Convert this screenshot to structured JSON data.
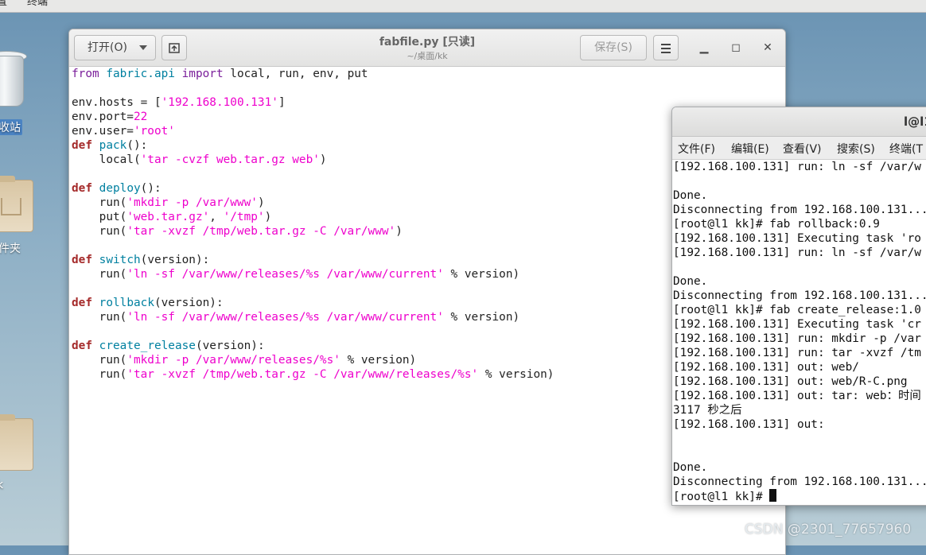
{
  "topbar": {
    "menu_partial": "置",
    "terminal_menu": "终端"
  },
  "desktop": {
    "trash_label": "收站",
    "folder1_label": "件夹",
    "folder2_label": "k"
  },
  "editor": {
    "open_label": "打开(O)",
    "save_label": "保存(S)",
    "title": "fabfile.py [只读]",
    "subtitle": "~/桌面/kk",
    "code_lines": [
      [
        {
          "t": "from",
          "c": "kw2"
        },
        {
          "t": " "
        },
        {
          "t": "fabric.api",
          "c": "fn"
        },
        {
          "t": " "
        },
        {
          "t": "import",
          "c": "kw2"
        },
        {
          "t": " local, run, env, put"
        }
      ],
      [],
      [
        {
          "t": "env.hosts = ["
        },
        {
          "t": "'192.168.100.131'",
          "c": "str"
        },
        {
          "t": "]"
        }
      ],
      [
        {
          "t": "env.port="
        },
        {
          "t": "22",
          "c": "num"
        }
      ],
      [
        {
          "t": "env.user="
        },
        {
          "t": "'root'",
          "c": "str"
        }
      ],
      [
        {
          "t": "def",
          "c": "kw"
        },
        {
          "t": " "
        },
        {
          "t": "pack",
          "c": "fn"
        },
        {
          "t": "():"
        }
      ],
      [
        {
          "t": "    local("
        },
        {
          "t": "'tar -cvzf web.tar.gz web'",
          "c": "str"
        },
        {
          "t": ")"
        }
      ],
      [],
      [
        {
          "t": "def",
          "c": "kw"
        },
        {
          "t": " "
        },
        {
          "t": "deploy",
          "c": "fn"
        },
        {
          "t": "():"
        }
      ],
      [
        {
          "t": "    run("
        },
        {
          "t": "'mkdir -p /var/www'",
          "c": "str"
        },
        {
          "t": ")"
        }
      ],
      [
        {
          "t": "    put("
        },
        {
          "t": "'web.tar.gz'",
          "c": "str"
        },
        {
          "t": ", "
        },
        {
          "t": "'/tmp'",
          "c": "str"
        },
        {
          "t": ")"
        }
      ],
      [
        {
          "t": "    run("
        },
        {
          "t": "'tar -xvzf /tmp/web.tar.gz -C /var/www'",
          "c": "str"
        },
        {
          "t": ")"
        }
      ],
      [],
      [
        {
          "t": "def",
          "c": "kw"
        },
        {
          "t": " "
        },
        {
          "t": "switch",
          "c": "fn"
        },
        {
          "t": "(version):"
        }
      ],
      [
        {
          "t": "    run("
        },
        {
          "t": "'ln -sf /var/www/releases/%s /var/www/current'",
          "c": "str"
        },
        {
          "t": " % version)"
        }
      ],
      [],
      [
        {
          "t": "def",
          "c": "kw"
        },
        {
          "t": " "
        },
        {
          "t": "rollback",
          "c": "fn"
        },
        {
          "t": "(version):"
        }
      ],
      [
        {
          "t": "    run("
        },
        {
          "t": "'ln -sf /var/www/releases/%s /var/www/current'",
          "c": "str"
        },
        {
          "t": " % version)"
        }
      ],
      [],
      [
        {
          "t": "def",
          "c": "kw"
        },
        {
          "t": " "
        },
        {
          "t": "create_release",
          "c": "fn"
        },
        {
          "t": "(version):"
        }
      ],
      [
        {
          "t": "    run("
        },
        {
          "t": "'mkdir -p /var/www/releases/%s'",
          "c": "str"
        },
        {
          "t": " % version)"
        }
      ],
      [
        {
          "t": "    run("
        },
        {
          "t": "'tar -xvzf /tmp/web.tar.gz -C /var/www/releases/%s'",
          "c": "str"
        },
        {
          "t": " % version)"
        }
      ]
    ]
  },
  "terminal": {
    "title": "l@l1",
    "menu": [
      "文件(F)",
      "编辑(E)",
      "查看(V)",
      "搜索(S)",
      "终端(T"
    ],
    "lines": [
      "[192.168.100.131] run: ln -sf /var/w",
      "",
      "Done.",
      "Disconnecting from 192.168.100.131...",
      "[root@l1 kk]# fab rollback:0.9",
      "[192.168.100.131] Executing task 'ro",
      "[192.168.100.131] run: ln -sf /var/w",
      "",
      "Done.",
      "Disconnecting from 192.168.100.131...",
      "[root@l1 kk]# fab create_release:1.0",
      "[192.168.100.131] Executing task 'cr",
      "[192.168.100.131] run: mkdir -p /var",
      "[192.168.100.131] run: tar -xvzf /tm",
      "[192.168.100.131] out: web/",
      "[192.168.100.131] out: web/R-C.png",
      "[192.168.100.131] out: tar: web：时间",
      "3117 秒之后",
      "[192.168.100.131] out:",
      "",
      "",
      "Done.",
      "Disconnecting from 192.168.100.131...",
      "[root@l1 kk]# "
    ]
  },
  "watermark": "CSDN @2301_77657960"
}
